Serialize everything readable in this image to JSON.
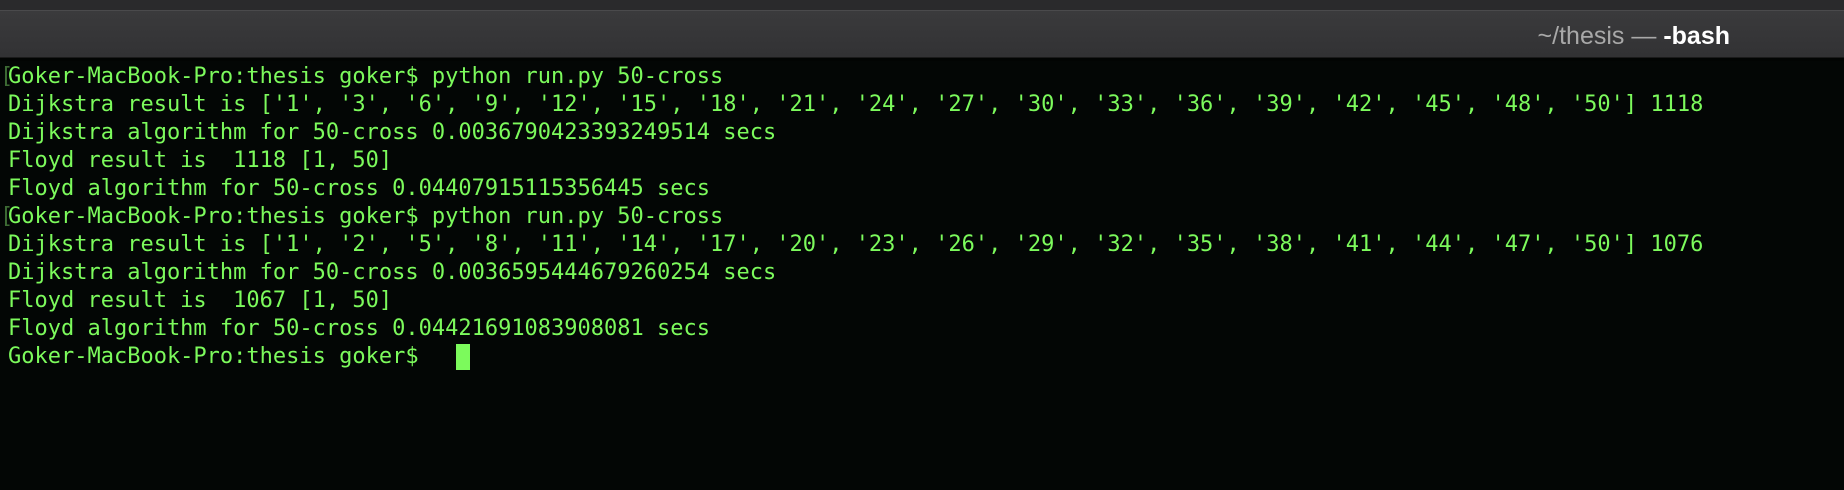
{
  "window": {
    "title_path": "~/thesis",
    "title_separator": " — ",
    "title_process": "-bash"
  },
  "terminal": {
    "lines": [
      "Goker-MacBook-Pro:thesis goker$ python run.py 50-cross",
      "Dijkstra result is ['1', '3', '6', '9', '12', '15', '18', '21', '24', '27', '30', '33', '36', '39', '42', '45', '48', '50'] 1118",
      "Dijkstra algorithm for 50-cross 0.0036790423393249514 secs",
      "Floyd result is  1118 [1, 50]",
      "Floyd algorithm for 50-cross 0.04407915115356445 secs",
      "Goker-MacBook-Pro:thesis goker$ python run.py 50-cross",
      "Dijkstra result is ['1', '2', '5', '8', '11', '14', '17', '20', '23', '26', '29', '32', '35', '38', '41', '44', '47', '50'] 1076",
      "Dijkstra algorithm for 50-cross 0.0036595444679260254 secs",
      "Floyd result is  1067 [1, 50]",
      "Floyd algorithm for 50-cross 0.04421691083908081 secs",
      "Goker-MacBook-Pro:thesis goker$ "
    ],
    "colors": {
      "text": "#7cfa5c",
      "background": "#030605",
      "cursor": "#7cfa5c"
    }
  }
}
